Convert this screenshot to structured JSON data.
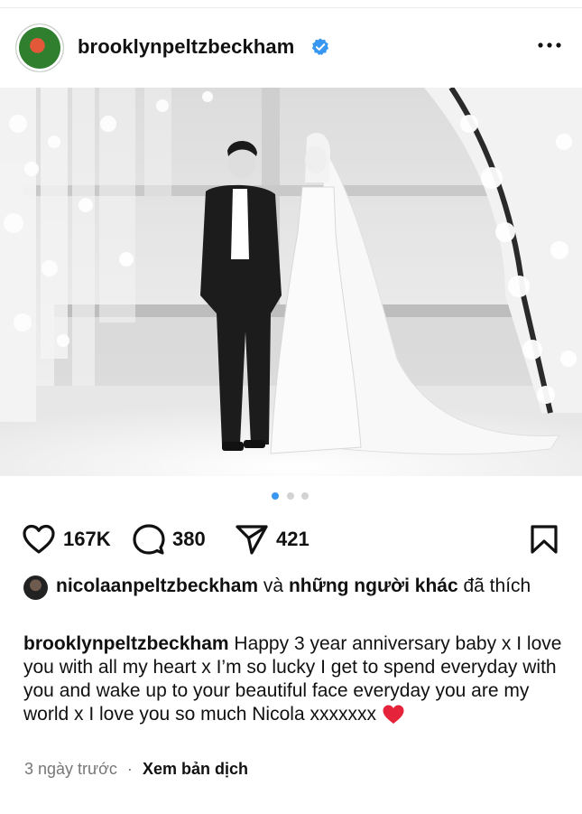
{
  "post": {
    "username": "brooklynpeltzbeckham",
    "verified": true,
    "menu_icon": "more-horizontal-icon"
  },
  "media": {
    "carousel_total": 3,
    "carousel_active": 1
  },
  "actions": {
    "like_count": "167K",
    "comment_count": "380",
    "share_count": "421"
  },
  "likes": {
    "liker": "nicolaanpeltzbeckham",
    "connector": "và",
    "others": "những người khác",
    "suffix": "đã thích"
  },
  "caption": {
    "username": "brooklynpeltzbeckham",
    "text": "Happy 3 year anniversary baby x I love you with all my heart x I’m so lucky I get to spend everyday with you and wake up to your beautiful face everyday you are my world x I love you so much Nicola xxxxxxx",
    "emoji": "red-heart-icon"
  },
  "meta": {
    "time": "3 ngày trước",
    "separator": "·",
    "translate": "Xem bản dịch"
  },
  "colors": {
    "verified_blue": "#3897f0",
    "dot_active": "#3897f0",
    "dot_inactive": "#d3d3d3",
    "heart_red": "#e5243b"
  }
}
